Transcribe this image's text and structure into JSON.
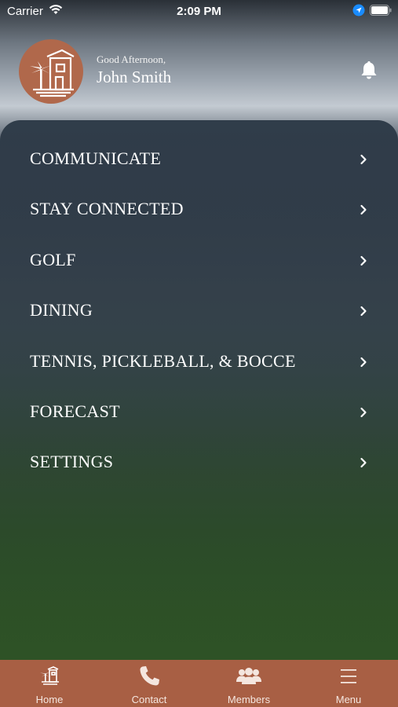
{
  "status_bar": {
    "carrier": "Carrier",
    "time": "2:09 PM"
  },
  "header": {
    "greeting": "Good Afternoon,",
    "user_name": "John Smith",
    "logo_icon": "club-tower-palm-logo",
    "notification_icon": "bell-icon"
  },
  "menu": {
    "items": [
      {
        "label": "COMMUNICATE"
      },
      {
        "label": "STAY CONNECTED"
      },
      {
        "label": "GOLF"
      },
      {
        "label": "DINING"
      },
      {
        "label": "TENNIS, PICKLEBALL, & BOCCE"
      },
      {
        "label": "FORECAST"
      },
      {
        "label": "SETTINGS"
      }
    ]
  },
  "tabbar": {
    "background": "#a85f44",
    "tabs": [
      {
        "label": "Home",
        "icon": "home-logo-icon"
      },
      {
        "label": "Contact",
        "icon": "phone-icon"
      },
      {
        "label": "Members",
        "icon": "members-icon"
      },
      {
        "label": "Menu",
        "icon": "hamburger-icon"
      }
    ]
  }
}
